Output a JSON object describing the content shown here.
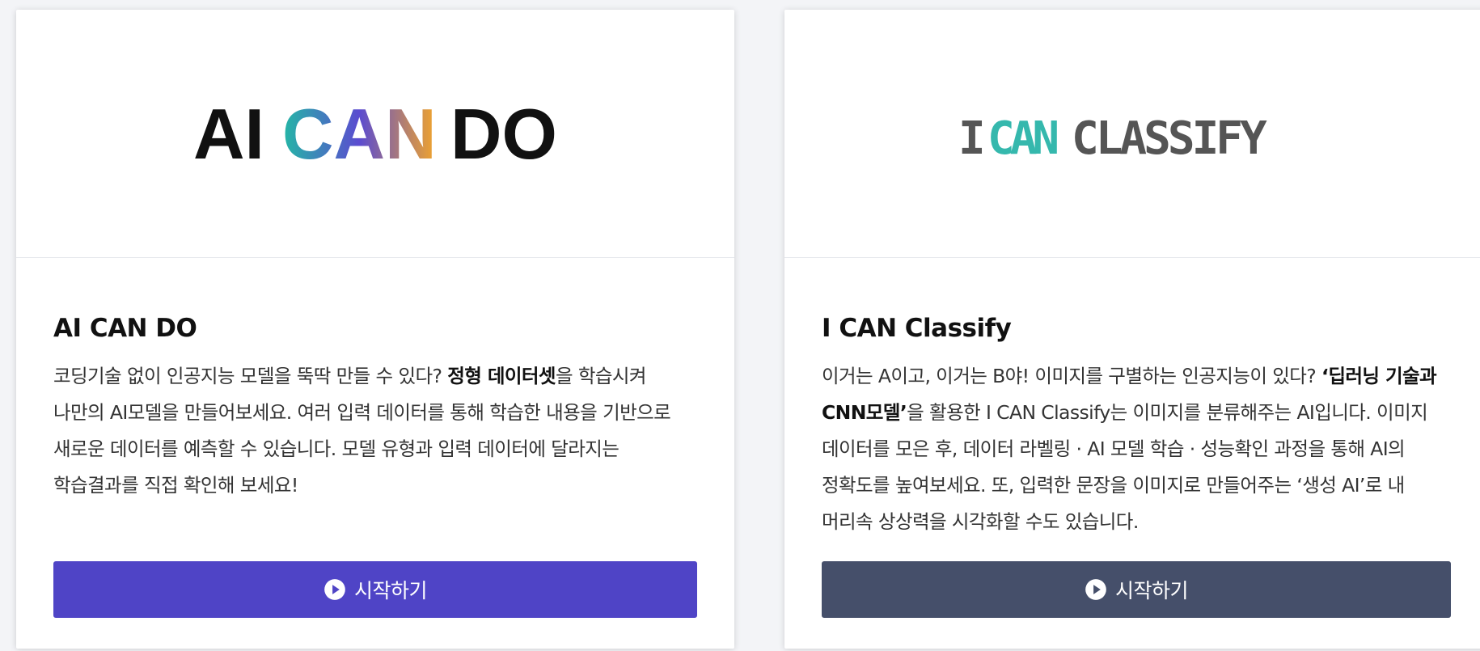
{
  "colors": {
    "primary_button": "#4f44c6",
    "secondary_button": "#454f6a",
    "teal": "#2ab5a5",
    "purple": "#6a46c9",
    "orange": "#f0a12a"
  },
  "cards": [
    {
      "logo": {
        "word1": "AI",
        "word2": "CAN",
        "word3": "DO"
      },
      "title": "AI CAN DO",
      "description": {
        "part1": "코딩기술 없이 인공지능 모델을 뚝딱 만들 수 있다? ",
        "bold1": "정형 데이터셋",
        "part2": "을 학습시켜 나만의 AI모델을 만들어보세요. 여러 입력 데이터를 통해 학습한 내용을 기반으로 새로운 데이터를 예측할 수 있습니다. 모델 유형과 입력 데이터에 달라지는 학습결과를 직접 확인해 보세요!"
      },
      "button_label": "시작하기",
      "button_icon": "play-circle-icon"
    },
    {
      "logo": {
        "word1": "I",
        "word2": "CAN",
        "word3": "CLASSIFY"
      },
      "title": "I CAN Classify",
      "description": {
        "part1": "이거는 A이고, 이거는 B야! 이미지를 구별하는 인공지능이 있다? ",
        "bold1": "‘딥러닝 기술과 CNN모델’",
        "part2": "을 활용한 I CAN Classify는 이미지를 분류해주는 AI입니다. 이미지 데이터를 모은 후, 데이터 라벨링 · AI 모델 학습 · 성능확인 과정을 통해 AI의 정확도를 높여보세요. 또, 입력한 문장을 이미지로 만들어주는 ‘생성 AI’로 내 머리속 상상력을 시각화할 수도 있습니다."
      },
      "button_label": "시작하기",
      "button_icon": "play-circle-icon"
    }
  ]
}
